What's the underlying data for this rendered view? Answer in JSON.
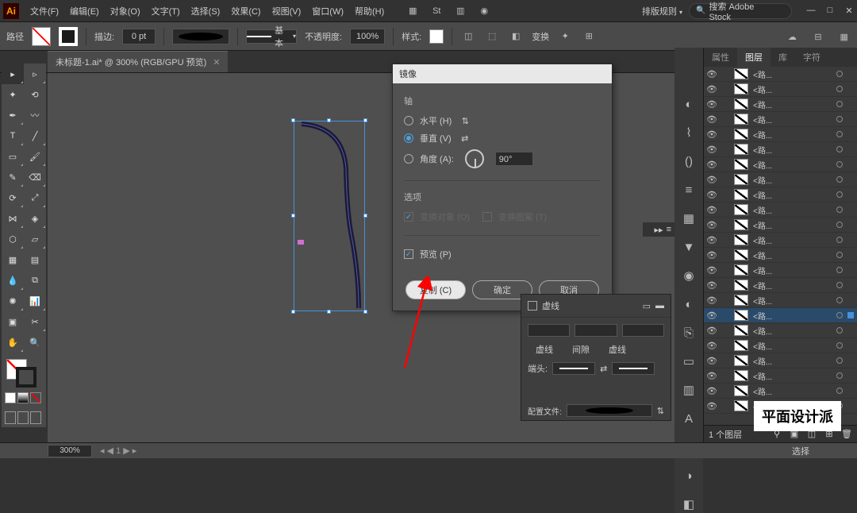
{
  "app": {
    "logo": "Ai"
  },
  "menubar": [
    "文件(F)",
    "编辑(E)",
    "对象(O)",
    "文字(T)",
    "选择(S)",
    "效果(C)",
    "视图(V)",
    "窗口(W)",
    "帮助(H)"
  ],
  "title_right": {
    "arrange": "排版规则",
    "search_placeholder": "搜索 Adobe Stock"
  },
  "option_bar": {
    "label": "路径",
    "stroke_label": "描边:",
    "stroke_pt": "0 pt",
    "style_label": "基本",
    "opacity_label": "不透明度:",
    "opacity_value": "100%",
    "style2_label": "样式:",
    "transform_label": "变换"
  },
  "document_tab": {
    "title": "未标题-1.ai* @ 300% (RGB/GPU 预览)"
  },
  "dialog": {
    "title": "镜像",
    "axis_section": "轴",
    "horizontal": "水平 (H)",
    "vertical": "垂直 (V)",
    "angle_label": "角度 (A):",
    "angle_value": "90°",
    "options_section": "选项",
    "opt_transform_objects": "变换对象 (O)",
    "opt_transform_patterns": "变换图案 (T)",
    "preview": "预览 (P)",
    "btn_copy": "复制 (C)",
    "btn_ok": "确定",
    "btn_cancel": "取消"
  },
  "panel_tabs": [
    "属性",
    "图层",
    "库",
    "字符"
  ],
  "active_panel_tab": 1,
  "layer_item_name": "<路...",
  "layers_footer": {
    "count": "1 个图层"
  },
  "stroke_panel": {
    "title": "虚线",
    "caps_label": "端头:",
    "profile_label": "配置文件:"
  },
  "statusbar": {
    "zoom": "300%",
    "tool": "选择"
  },
  "watermark": "平面设计派"
}
